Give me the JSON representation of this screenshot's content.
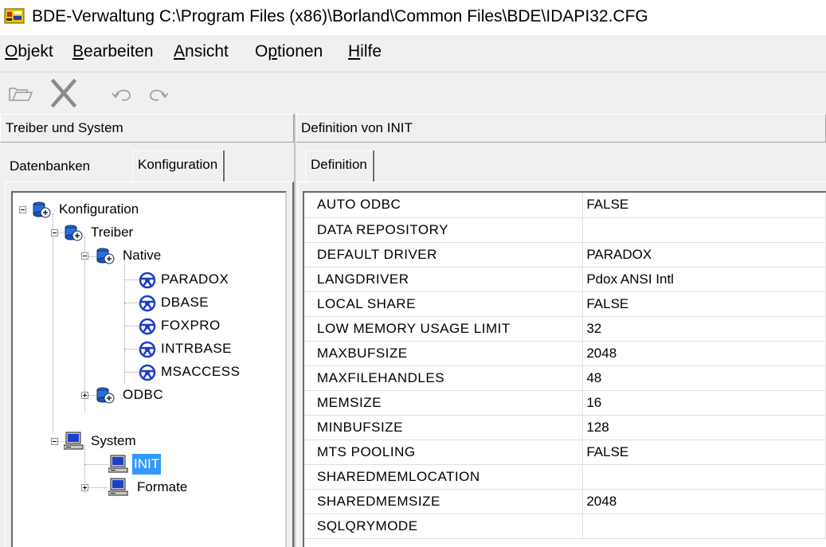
{
  "window": {
    "title": "BDE-Verwaltung  C:\\Program Files (x86)\\Borland\\Common Files\\BDE\\IDAPI32.CFG",
    "icon": "bde-app-icon"
  },
  "menu": [
    {
      "key": "O",
      "rest": "bjekt"
    },
    {
      "key": "B",
      "rest": "earbeiten"
    },
    {
      "key": "A",
      "rest": "nsicht"
    },
    {
      "pre": "O",
      "key": "p",
      "rest": "tionen"
    },
    {
      "key": "H",
      "rest": "ilfe"
    }
  ],
  "toolbar": {
    "buttons": [
      "open-folder-icon",
      "delete-x-icon",
      "undo-icon",
      "redo-icon"
    ]
  },
  "left": {
    "header": "Treiber und System",
    "tabs": [
      "Datenbanken",
      "Konfiguration"
    ],
    "active_tab": "Konfiguration",
    "tree": [
      {
        "label": "Konfiguration",
        "icon": "database-config-icon"
      },
      {
        "label": "Treiber",
        "icon": "database-config-icon"
      },
      {
        "label": "Native",
        "icon": "database-config-icon"
      },
      {
        "label": "PARADOX",
        "icon": "driver-icon"
      },
      {
        "label": "DBASE",
        "icon": "driver-icon"
      },
      {
        "label": "FOXPRO",
        "icon": "driver-icon"
      },
      {
        "label": "INTRBASE",
        "icon": "driver-icon"
      },
      {
        "label": "MSACCESS",
        "icon": "driver-icon"
      },
      {
        "label": "ODBC",
        "icon": "database-config-icon"
      },
      {
        "label": "System",
        "icon": "computer-icon"
      },
      {
        "label": "INIT",
        "icon": "computer-icon",
        "selected": true
      },
      {
        "label": "Formate",
        "icon": "computer-icon"
      }
    ]
  },
  "right": {
    "header": "Definition von INIT",
    "tab": "Definition",
    "rows": [
      {
        "key": "AUTO ODBC",
        "value": "FALSE"
      },
      {
        "key": "DATA REPOSITORY",
        "value": ""
      },
      {
        "key": "DEFAULT DRIVER",
        "value": "PARADOX"
      },
      {
        "key": "LANGDRIVER",
        "value": "Pdox ANSI Intl"
      },
      {
        "key": "LOCAL SHARE",
        "value": "FALSE"
      },
      {
        "key": "LOW MEMORY USAGE LIMIT",
        "value": "32"
      },
      {
        "key": "MAXBUFSIZE",
        "value": "2048"
      },
      {
        "key": "MAXFILEHANDLES",
        "value": "48"
      },
      {
        "key": "MEMSIZE",
        "value": "16"
      },
      {
        "key": "MINBUFSIZE",
        "value": "128"
      },
      {
        "key": "MTS POOLING",
        "value": "FALSE"
      },
      {
        "key": "SHAREDMEMLOCATION",
        "value": ""
      },
      {
        "key": "SHAREDMEMSIZE",
        "value": "2048"
      },
      {
        "key": "SQLQRYMODE",
        "value": ""
      }
    ]
  },
  "colors": {
    "selection": "#3399ff",
    "driver_icon": "#1e3cc8",
    "window_bg": "#f0f0f0"
  }
}
